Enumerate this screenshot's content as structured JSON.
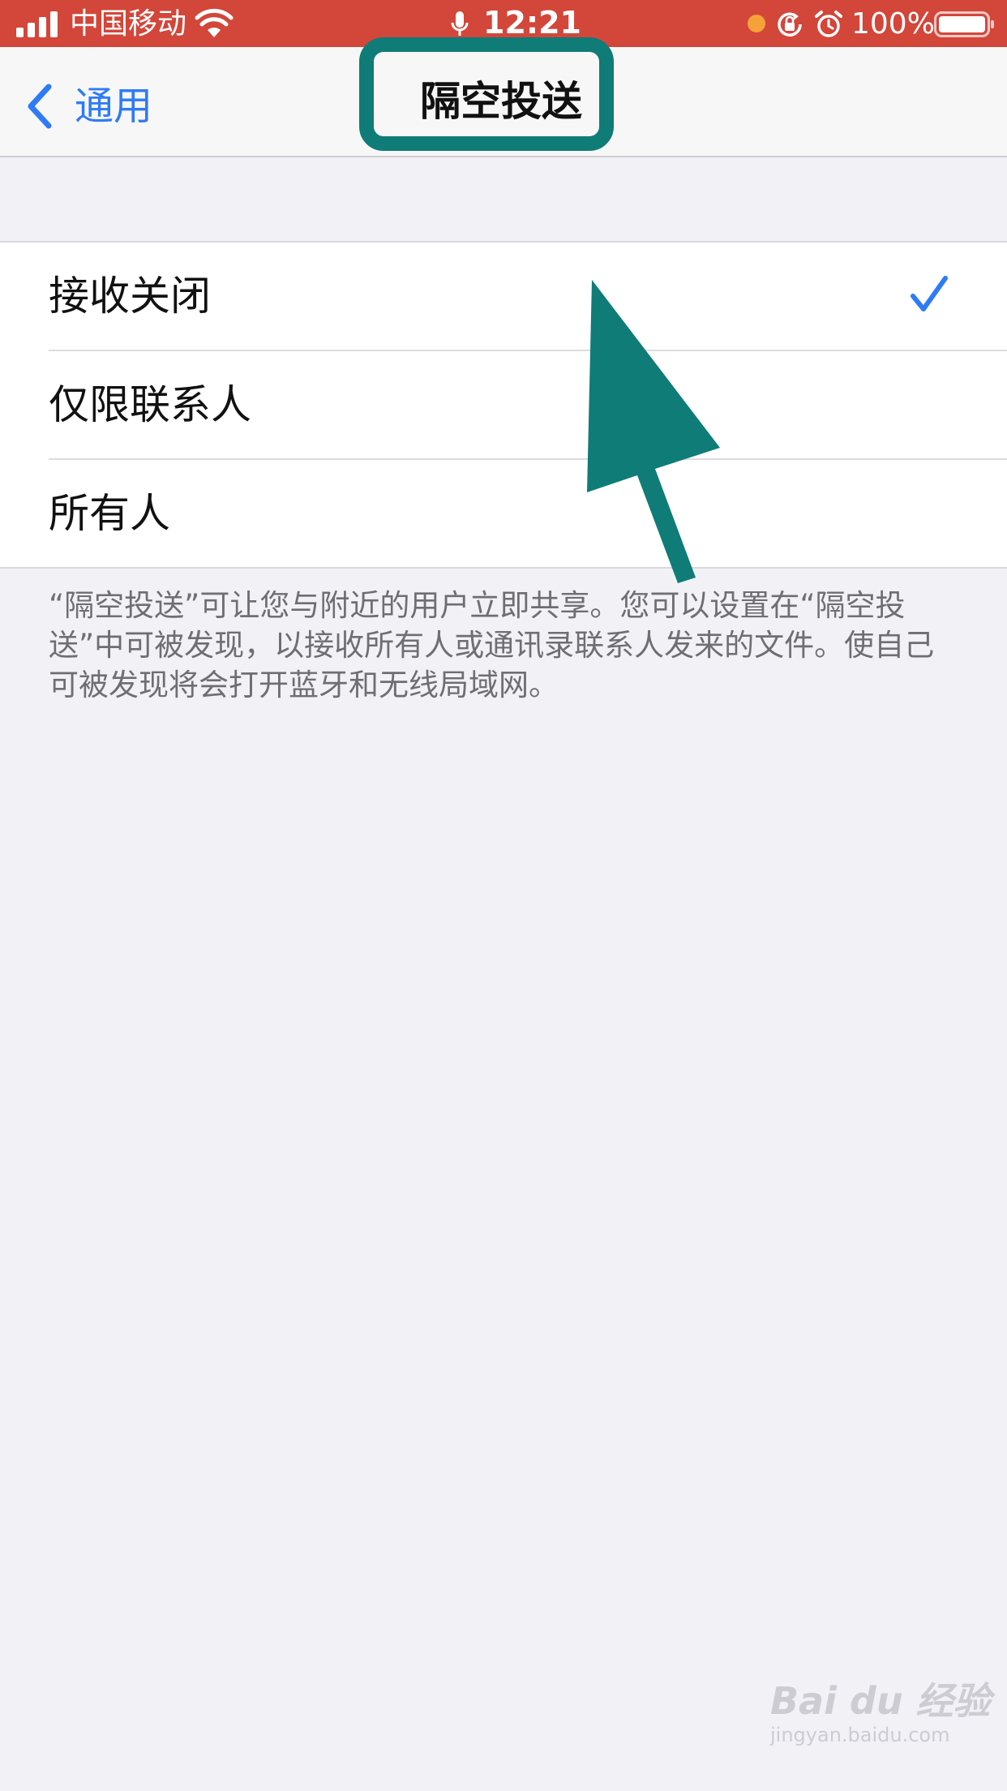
{
  "status_bar": {
    "carrier": "中国移动",
    "time": "12:21",
    "battery": "100%",
    "background": "#d3463a"
  },
  "nav": {
    "back_label": "通用",
    "title": "隔空投送",
    "accent": "#2f7bf6"
  },
  "options": [
    {
      "label": "接收关闭",
      "selected": true
    },
    {
      "label": "仅限联系人",
      "selected": false
    },
    {
      "label": "所有人",
      "selected": false
    }
  ],
  "footer": {
    "text": "“隔空投送”可让您与附近的用户立即共享。您可以设置在“隔空投送”中可被发现，以接收所有人或通讯录联系人发来的文件。使自己可被发现将会打开蓝牙和无线局域网。"
  },
  "annotation": {
    "color": "#0f7c77"
  },
  "watermark": {
    "logo": "Bai du 经验",
    "url": "jingyan.baidu.com"
  }
}
